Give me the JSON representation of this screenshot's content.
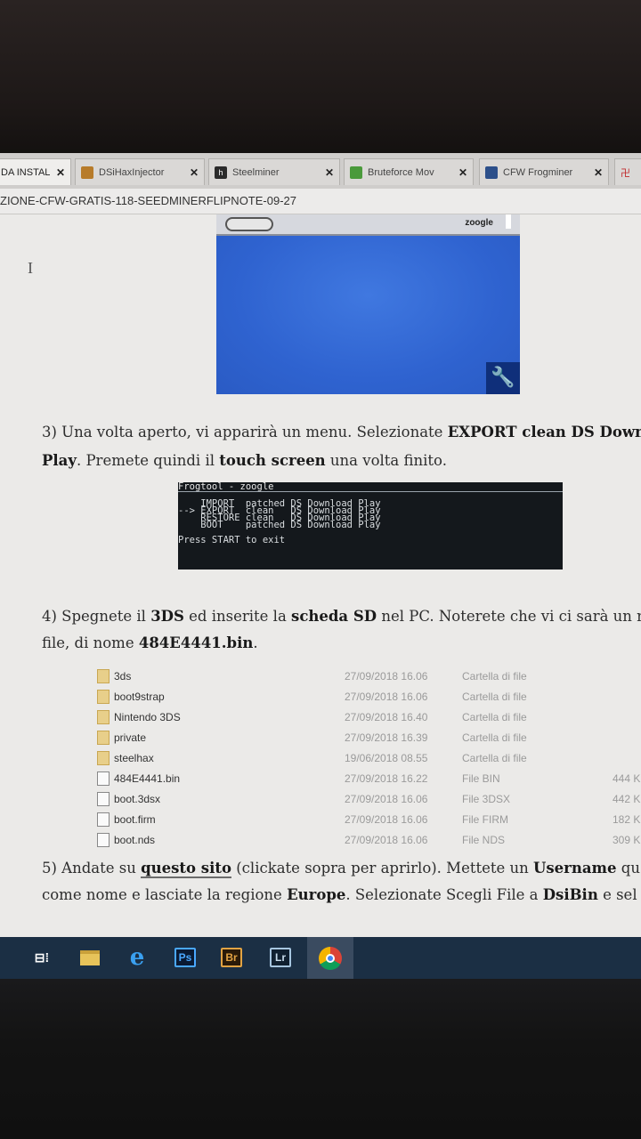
{
  "browser": {
    "tabs": [
      {
        "label": "DA INSTAL",
        "close": "✕",
        "icon_color": "#e7e7e7"
      },
      {
        "label": "DSiHaxInjector",
        "close": "✕",
        "icon_color": "#b77b2a"
      },
      {
        "label": "Steelminer",
        "close": "✕",
        "icon_color": "#2b2b2b"
      },
      {
        "label": "Bruteforce Mov",
        "close": "✕",
        "icon_color": "#4a9a3b"
      },
      {
        "label": "CFW Frogminer",
        "close": "✕",
        "icon_color": "#2c4f8a"
      }
    ],
    "extra_tab_icon": "卍",
    "url": "ZIONE-CFW-GRATIS-118-SEEDMINERFLIPNOTE-09-27"
  },
  "image1": {
    "username": "zoogle",
    "wrench_icon": "🔧"
  },
  "step3": {
    "line1": {
      "pre": "3) Una volta aperto, vi apparirà un menu. Selezionate ",
      "bold": "EXPORT clean DS Down"
    },
    "line2": {
      "bold1": "Play",
      "mid": ". Premete quindi il ",
      "bold2": "touch screen",
      "post": " una volta finito."
    }
  },
  "terminal": {
    "header": "Frogtool - zoogle",
    "rows": [
      "    IMPORT  patched DS Download Play",
      "--> EXPORT  clean   DS Download Play",
      "    RESTORE clean   DS Download Play",
      "    BOOT    patched DS Download Play"
    ],
    "footer": "Press START to exit"
  },
  "step4": {
    "line1": {
      "pre": "4) Spegnete il ",
      "bold1": "3DS",
      "mid": " ed inserite la ",
      "bold2": "scheda SD",
      "post": " nel PC. Noterete che vi ci sarà un n"
    },
    "line2": {
      "pre": "file, di nome ",
      "bold": "484E4441.bin",
      "post": "."
    }
  },
  "files": [
    {
      "name": "3ds",
      "date": "27/09/2018 16.06",
      "type": "Cartella di file",
      "size": "",
      "kind": "folder"
    },
    {
      "name": "boot9strap",
      "date": "27/09/2018 16.06",
      "type": "Cartella di file",
      "size": "",
      "kind": "folder"
    },
    {
      "name": "Nintendo 3DS",
      "date": "27/09/2018 16.40",
      "type": "Cartella di file",
      "size": "",
      "kind": "folder"
    },
    {
      "name": "private",
      "date": "27/09/2018 16.39",
      "type": "Cartella di file",
      "size": "",
      "kind": "folder"
    },
    {
      "name": "steelhax",
      "date": "19/06/2018 08.55",
      "type": "Cartella di file",
      "size": "",
      "kind": "folder"
    },
    {
      "name": "484E4441.bin",
      "date": "27/09/2018 16.22",
      "type": "File BIN",
      "size": "444 K",
      "kind": "file"
    },
    {
      "name": "boot.3dsx",
      "date": "27/09/2018 16.06",
      "type": "File 3DSX",
      "size": "442 K",
      "kind": "file"
    },
    {
      "name": "boot.firm",
      "date": "27/09/2018 16.06",
      "type": "File FIRM",
      "size": "182 K",
      "kind": "file"
    },
    {
      "name": "boot.nds",
      "date": "27/09/2018 16.06",
      "type": "File NDS",
      "size": "309 K",
      "kind": "file"
    }
  ],
  "step5": {
    "line1": {
      "pre": "5) Andate su ",
      "link": "questo sito",
      "mid": " (clickate sopra per aprirlo). Mettete un ",
      "bold": "Username",
      "post": " qu"
    },
    "line2": {
      "pre": "come nome e lasciate la regione ",
      "bold1": "Europe",
      "mid": ". Selezionate Scegli File a ",
      "bold2": "DsiBin",
      "post": " e sel"
    }
  },
  "taskbar": {
    "items": [
      {
        "id": "task-view",
        "label": "⊟⁞"
      },
      {
        "id": "file-explorer",
        "label": ""
      },
      {
        "id": "edge",
        "label": "e"
      },
      {
        "id": "photoshop",
        "label": "Ps"
      },
      {
        "id": "bridge",
        "label": "Br"
      },
      {
        "id": "lightroom",
        "label": "Lr"
      },
      {
        "id": "chrome",
        "label": ""
      }
    ]
  }
}
